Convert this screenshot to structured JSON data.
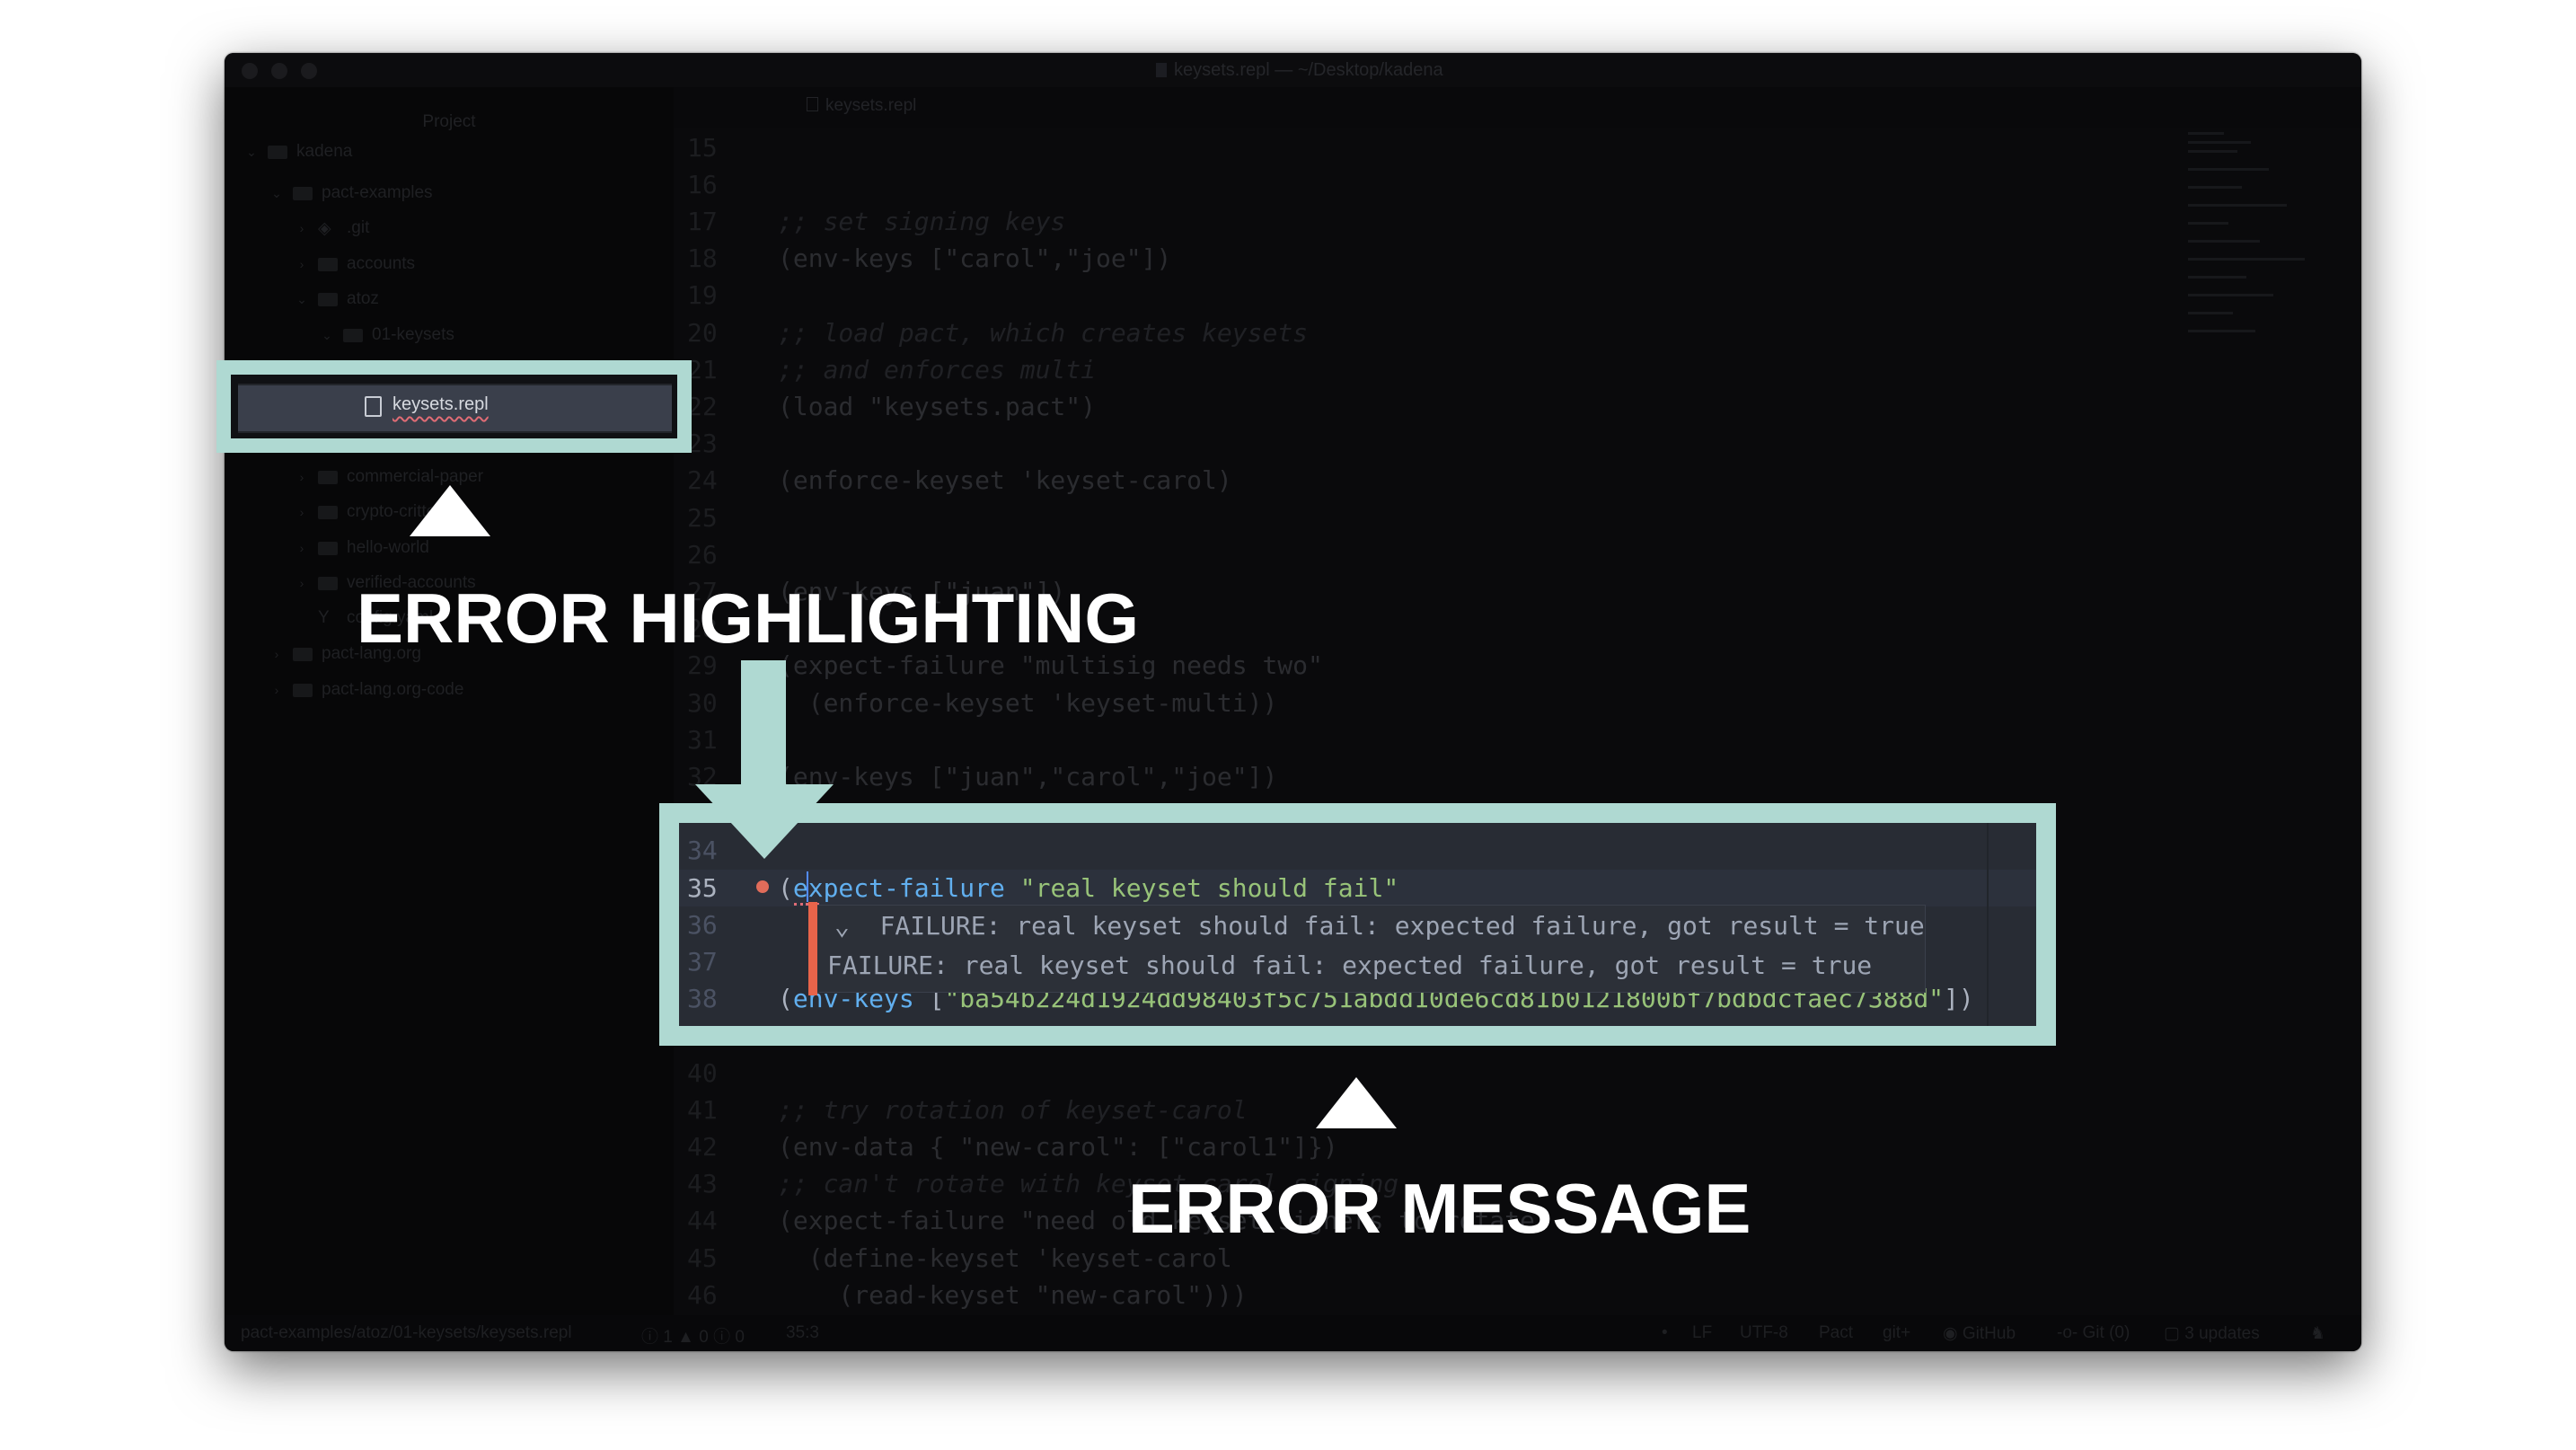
{
  "window": {
    "title": "keysets.repl — ~/Desktop/kadena",
    "traffic_lights": [
      "close",
      "minimize",
      "zoom"
    ]
  },
  "sidebar": {
    "header": "Project",
    "items": [
      {
        "label": "kadena",
        "level": 0,
        "expanded": true,
        "icon": "folder-icon"
      },
      {
        "label": "pact-examples",
        "level": 1,
        "expanded": true,
        "icon": "folder-icon"
      },
      {
        "label": ".git",
        "level": 2,
        "expanded": false,
        "icon": "git-icon"
      },
      {
        "label": "accounts",
        "level": 2,
        "expanded": false,
        "icon": "folder-icon"
      },
      {
        "label": "atoz",
        "level": 2,
        "expanded": true,
        "icon": "folder-icon"
      },
      {
        "label": "01-keysets",
        "level": 3,
        "expanded": true,
        "icon": "folder-icon"
      },
      {
        "label": "commercial-paper",
        "level": 2,
        "expanded": false,
        "icon": "folder-icon"
      },
      {
        "label": "crypto-critters",
        "level": 2,
        "expanded": false,
        "icon": "folder-icon"
      },
      {
        "label": "hello-world",
        "level": 2,
        "expanded": false,
        "icon": "folder-icon"
      },
      {
        "label": "verified-accounts",
        "level": 2,
        "expanded": false,
        "icon": "folder-icon"
      },
      {
        "label": "config.yaml",
        "level": 2,
        "icon": "yaml-icon"
      },
      {
        "label": "pact-lang.org",
        "level": 1,
        "expanded": false,
        "icon": "folder-icon"
      },
      {
        "label": "pact-lang.org-code",
        "level": 1,
        "expanded": false,
        "icon": "folder-icon"
      }
    ],
    "selected": {
      "label": "keysets.repl",
      "icon": "file-icon",
      "has_error": true
    }
  },
  "tab": {
    "label": "keysets.repl",
    "icon": "file-icon"
  },
  "editor": {
    "lines": [
      {
        "n": "15",
        "tokens": []
      },
      {
        "n": "16",
        "tokens": []
      },
      {
        "n": "17",
        "tokens": [
          {
            "k": "c",
            "t": ";; set signing keys"
          }
        ]
      },
      {
        "n": "18",
        "tokens": [
          {
            "k": "p",
            "t": "(env-keys [\"carol\",\"joe\"])"
          }
        ]
      },
      {
        "n": "19",
        "tokens": []
      },
      {
        "n": "20",
        "tokens": [
          {
            "k": "c",
            "t": ";; load pact, which creates keysets"
          }
        ]
      },
      {
        "n": "21",
        "tokens": [
          {
            "k": "c",
            "t": ";; and enforces multi"
          }
        ]
      },
      {
        "n": "22",
        "tokens": [
          {
            "k": "p",
            "t": "(load \"keysets.pact\")"
          }
        ]
      },
      {
        "n": "23",
        "tokens": []
      },
      {
        "n": "24",
        "tokens": [
          {
            "k": "p",
            "t": "(enforce-keyset 'keyset-carol)"
          }
        ]
      },
      {
        "n": "25",
        "tokens": []
      },
      {
        "n": "26",
        "tokens": []
      },
      {
        "n": "27",
        "tokens": [
          {
            "k": "p",
            "t": "(env-keys [\"juan\"])"
          }
        ]
      },
      {
        "n": "28",
        "tokens": []
      },
      {
        "n": "29",
        "tokens": [
          {
            "k": "p",
            "t": "(expect-failure \"multisig needs two\""
          }
        ]
      },
      {
        "n": "30",
        "tokens": [
          {
            "k": "p",
            "t": "  (enforce-keyset 'keyset-multi))"
          }
        ]
      },
      {
        "n": "31",
        "tokens": []
      },
      {
        "n": "32",
        "tokens": [
          {
            "k": "p",
            "t": "(env-keys [\"juan\",\"carol\",\"joe\"])"
          }
        ]
      },
      {
        "n": "40",
        "tokens": []
      },
      {
        "n": "41",
        "tokens": [
          {
            "k": "c",
            "t": ";; try rotation of keyset-carol"
          }
        ]
      },
      {
        "n": "42",
        "tokens": [
          {
            "k": "p",
            "t": "(env-data { \"new-carol\": [\"carol1\"]})"
          }
        ]
      },
      {
        "n": "43",
        "tokens": [
          {
            "k": "c",
            "t": ";; can't rotate with keyset-carol signing"
          }
        ]
      },
      {
        "n": "44",
        "tokens": [
          {
            "k": "p",
            "t": "(expect-failure \"need old keyset signers to rotate\""
          }
        ]
      },
      {
        "n": "45",
        "tokens": [
          {
            "k": "p",
            "t": "  (define-keyset 'keyset-carol"
          }
        ]
      },
      {
        "n": "46",
        "tokens": [
          {
            "k": "p",
            "t": "    (read-keyset \"new-carol\")))"
          }
        ]
      }
    ],
    "focus_lines": [
      {
        "n": "34",
        "tokens": []
      },
      {
        "n": "35",
        "current": true,
        "error": true,
        "tokens": [
          {
            "k": "p",
            "t": "("
          },
          {
            "k": "f",
            "t": "expect-failure"
          },
          {
            "k": "p",
            "t": " "
          },
          {
            "k": "s",
            "t": "\"real keyset should fail\""
          }
        ]
      },
      {
        "n": "36",
        "tokens": []
      },
      {
        "n": "37",
        "tokens": []
      },
      {
        "n": "38",
        "tokens": [
          {
            "k": "p",
            "t": "("
          },
          {
            "k": "f",
            "t": "env-keys"
          },
          {
            "k": "p",
            "t": " ["
          },
          {
            "k": "s",
            "t": "\"ba54b224d1924dd98403f5c751abdd10de6cd81b0121800bf7bdbdcfaec7388d\""
          },
          {
            "k": "p",
            "t": "])"
          }
        ]
      }
    ],
    "error_tooltip": {
      "header": "⌄  FAILURE: real keyset should fail: expected failure, got result = true",
      "detail": "FAILURE: real keyset should fail: expected failure, got result = true"
    },
    "colors": {
      "function": "#61afef",
      "string": "#98c379",
      "error": "#e8644a",
      "background": "#282c34"
    }
  },
  "statusbar": {
    "path": "pact-examples/atoz/01-keysets/keysets.repl",
    "errors": "1",
    "warnings": "0",
    "infos": "0",
    "cursor": "35:3",
    "line_ending": "LF",
    "encoding": "UTF-8",
    "grammar": "Pact",
    "git_plus": "git+",
    "github": "GitHub",
    "git": "Git (0)",
    "updates": "3 updates"
  },
  "annotations": {
    "highlighting": "ERROR HIGHLIGHTING",
    "message": "ERROR MESSAGE",
    "accent": "#afd9d2"
  }
}
